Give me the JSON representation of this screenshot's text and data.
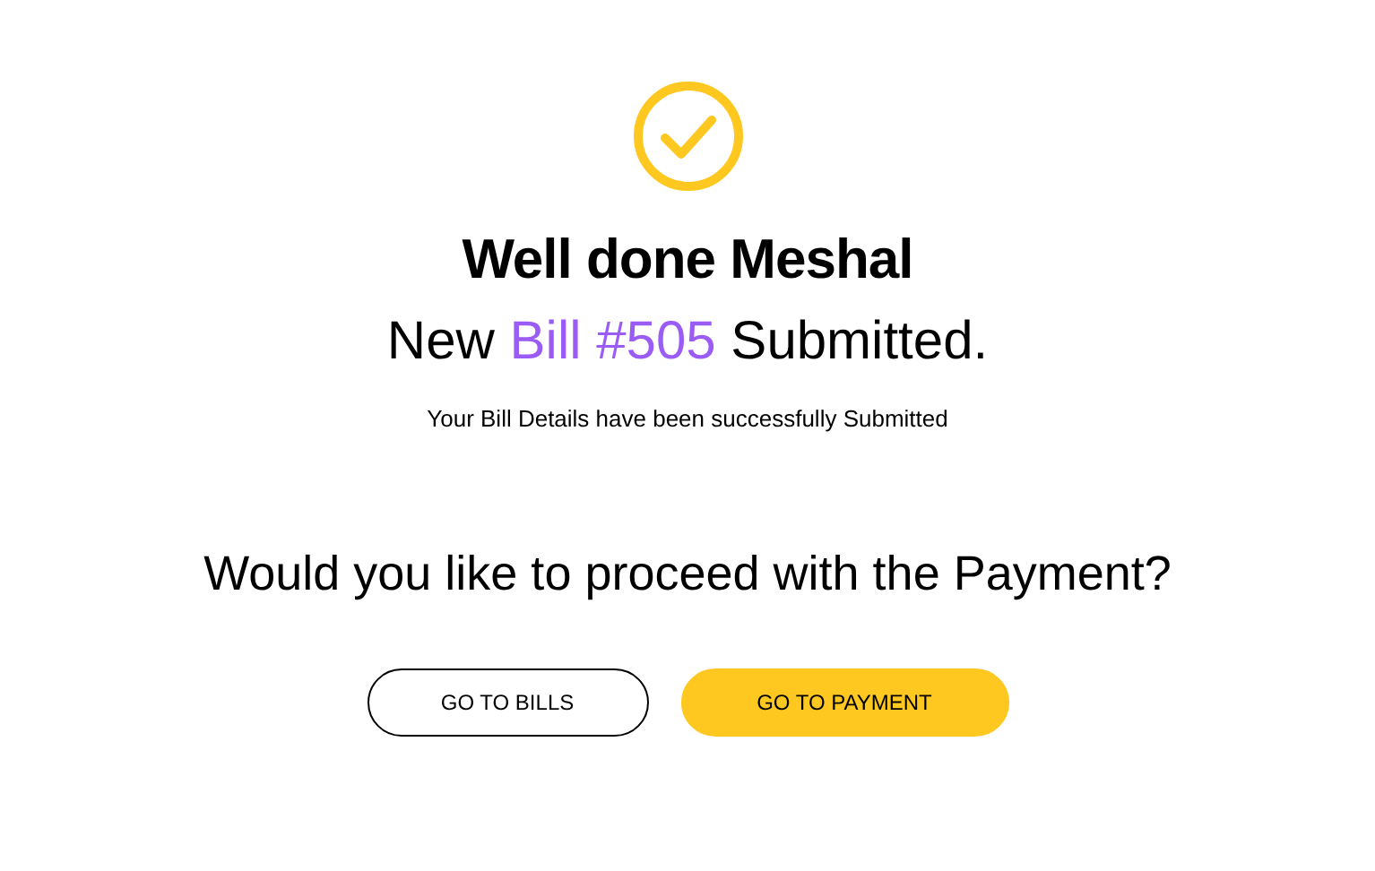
{
  "greeting": "Well done Meshal",
  "submitted": {
    "prefix": "New",
    "highlight": "Bill #505",
    "suffix": "Submitted."
  },
  "message": "Your Bill Details have been successfully Submitted",
  "question": "Would you like to proceed with the Payment?",
  "buttons": [
    {
      "label": "GO TO BILLS",
      "kind": "outline"
    },
    {
      "label": "GO TO PAYMENT",
      "kind": "primary"
    }
  ]
}
